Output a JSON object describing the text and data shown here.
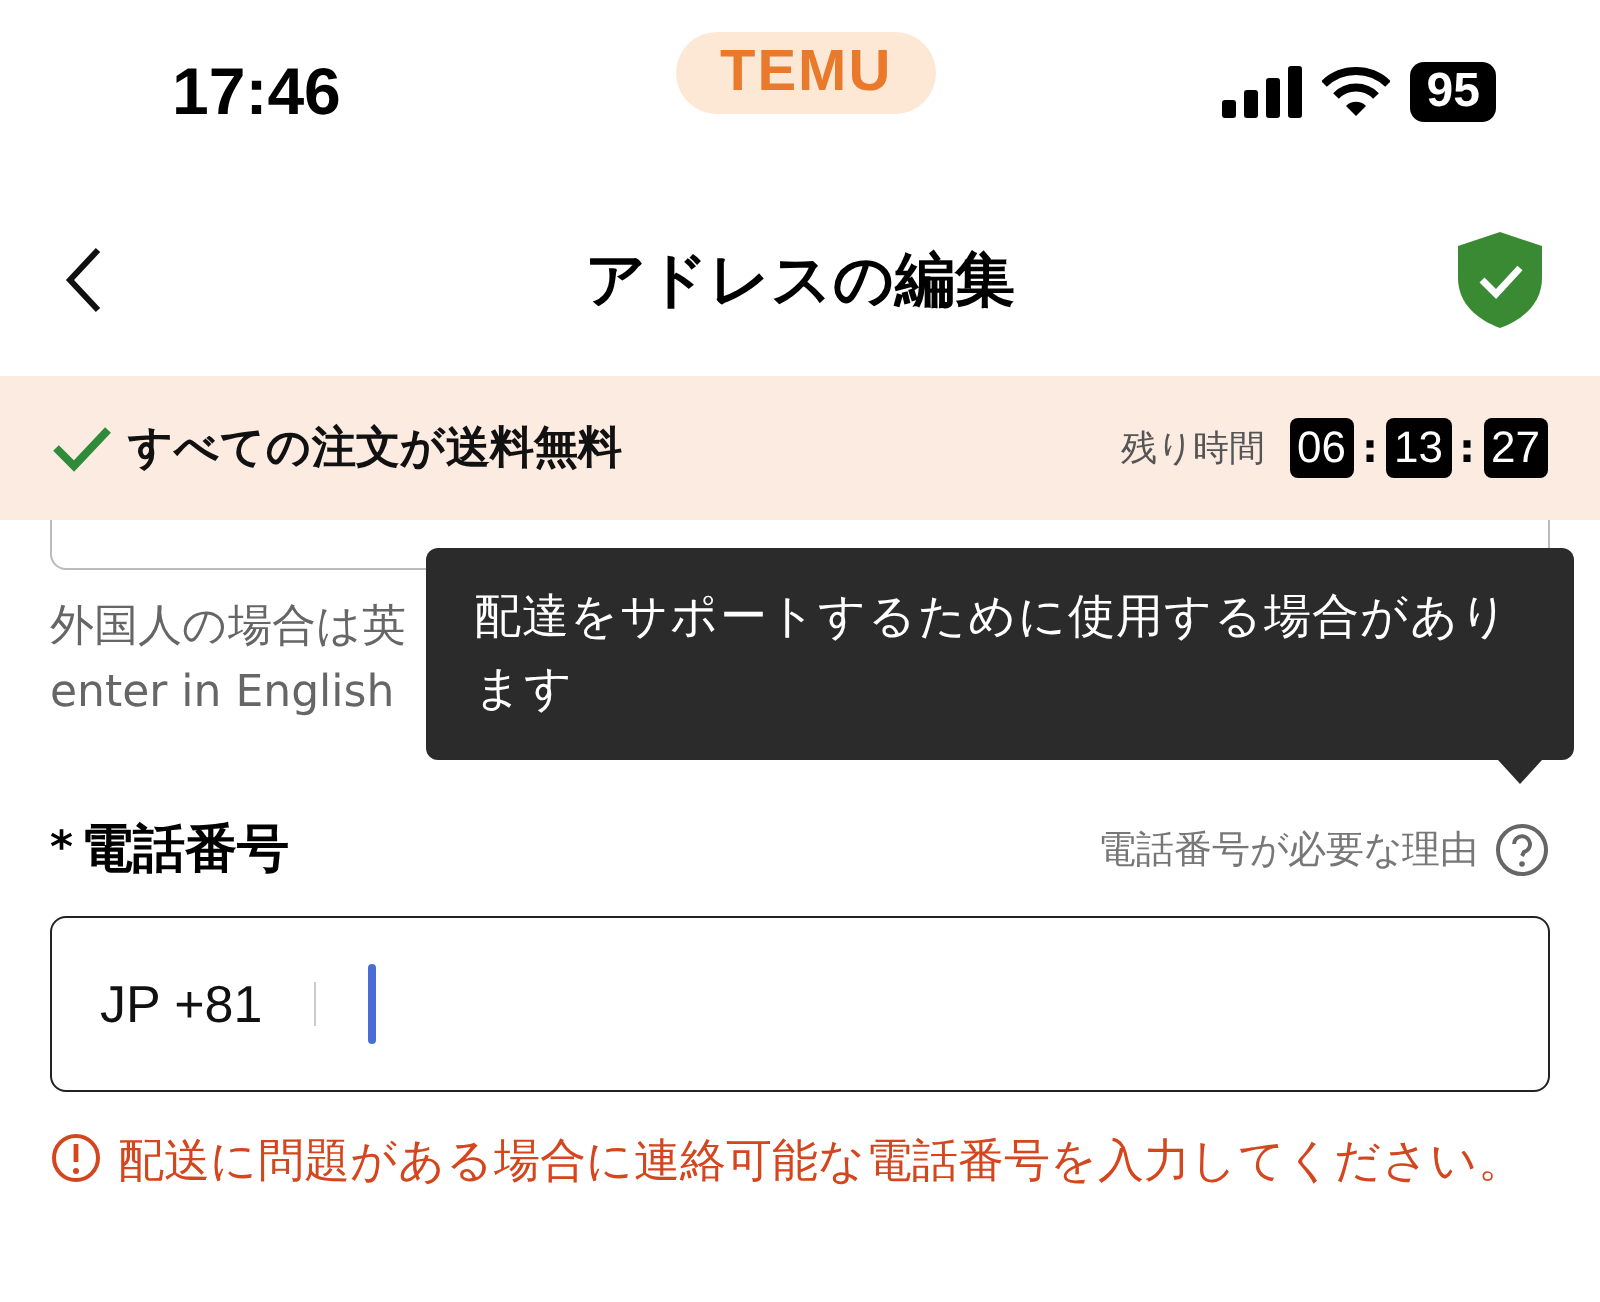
{
  "status_bar": {
    "time": "17:46",
    "app_badge": "TEMU",
    "battery": "95"
  },
  "header": {
    "title": "アドレスの編集"
  },
  "promo": {
    "text": "すべての注文が送料無料",
    "timer_label": "残り時間",
    "timer": [
      "06",
      "13",
      "27"
    ],
    "timer_separator": ":"
  },
  "hint": {
    "lines": [
      "外国人の場合は英",
      "enter in English"
    ]
  },
  "tooltip": {
    "text": "配達をサポートするために使用する場合があります"
  },
  "phone": {
    "required_mark": "*",
    "label": "電話番号",
    "help_link": "電話番号が必要な理由",
    "country_code": "JP +81",
    "error": "配送に問題がある場合に連絡可能な電話番号を入力してください。"
  }
}
